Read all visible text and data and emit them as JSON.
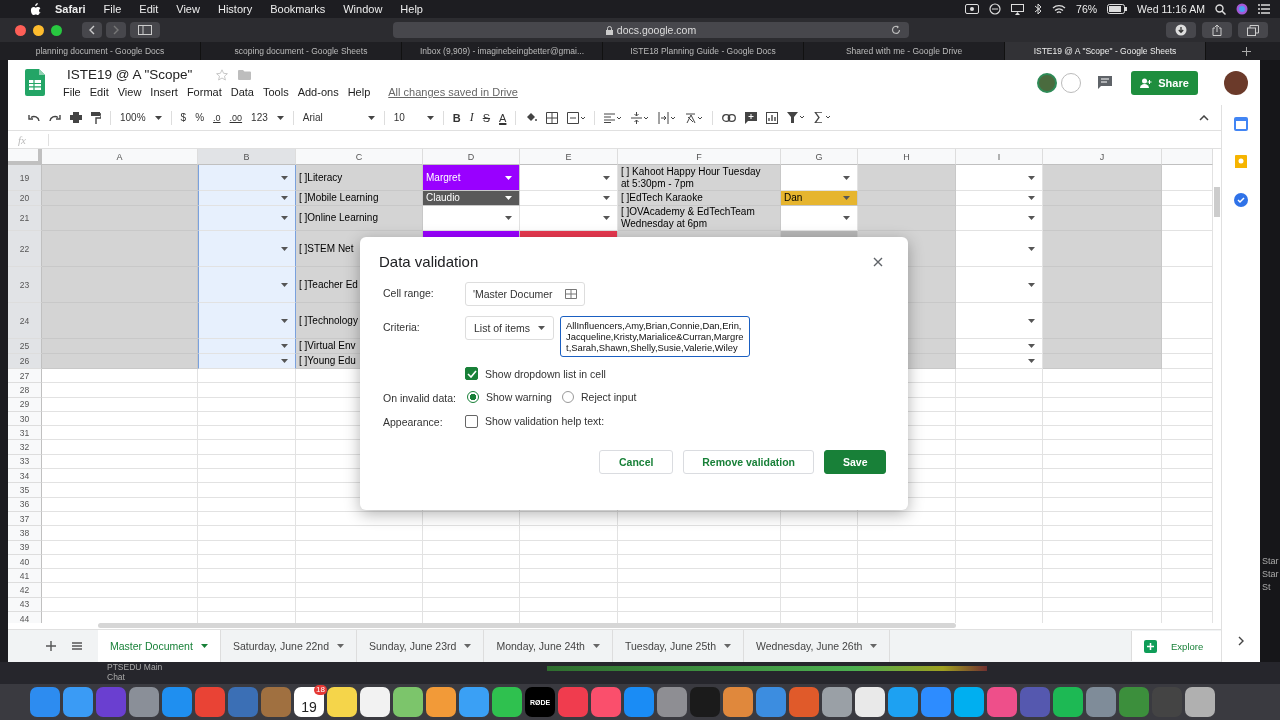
{
  "menubar": {
    "app": "Safari",
    "items": [
      "File",
      "Edit",
      "View",
      "History",
      "Bookmarks",
      "Window",
      "Help"
    ],
    "battery": "76%",
    "clock": "Wed 11:16 AM"
  },
  "browser": {
    "address": "docs.google.com",
    "tabs": [
      {
        "label": "planning document - Google Docs",
        "selected": false
      },
      {
        "label": "scoping document - Google Sheets",
        "selected": false
      },
      {
        "label": "Inbox (9,909) - imaginebeingbetter@gmai...",
        "selected": false
      },
      {
        "label": "ISTE18 Planning Guide - Google Docs",
        "selected": false
      },
      {
        "label": "Shared with me - Google Drive",
        "selected": false
      },
      {
        "label": "ISTE19 @ A \"Scope\" - Google Sheets",
        "selected": true
      }
    ]
  },
  "document": {
    "title": "ISTE19 @ A \"Scope\"",
    "menu": [
      "File",
      "Edit",
      "View",
      "Insert",
      "Format",
      "Data",
      "Tools",
      "Add-ons",
      "Help"
    ],
    "save_status": "All changes saved in Drive",
    "share": "Share"
  },
  "toolbar": {
    "zoom": "100%",
    "currency": "$",
    "percent": "%",
    "decrease_decimals": ".0",
    "increase_decimals": ".00",
    "number_format": "123",
    "font": "Arial",
    "font_size": "10",
    "bold": "B",
    "italic": "I",
    "strikethrough": "S",
    "text_color": "A"
  },
  "formula_bar": {
    "label": "fx"
  },
  "grid": {
    "columns": [
      {
        "label": "A",
        "selected": false
      },
      {
        "label": "B",
        "selected": true
      },
      {
        "label": "C",
        "selected": false
      },
      {
        "label": "D",
        "selected": false
      },
      {
        "label": "E",
        "selected": false
      },
      {
        "label": "F",
        "selected": false
      },
      {
        "label": "G",
        "selected": false
      },
      {
        "label": "H",
        "selected": false
      },
      {
        "label": "I",
        "selected": false
      },
      {
        "label": "J",
        "selected": false
      }
    ],
    "rows": [
      {
        "number": "19",
        "selected": true,
        "cells": [
          {
            "color": "#d4d4d4"
          },
          {
            "dropdown": true
          },
          {
            "text": "[ ]Literacy",
            "color": "#d4d4d4"
          },
          {
            "text": "Margret",
            "color": "#9900ff",
            "dropdown": true
          },
          {
            "dropdown": true
          },
          {
            "text": "[ ] Kahoot Happy Hour Tuesday at 5:30pm - 7pm",
            "color": "#d4d4d4"
          },
          {
            "dropdown": true
          },
          {
            "color": "#d4d4d4"
          },
          {
            "dropdown": true
          },
          {
            "color": "#d4d4d4"
          }
        ]
      },
      {
        "number": "20",
        "selected": true,
        "cells": [
          {
            "color": "#d4d4d4"
          },
          {
            "dropdown": true
          },
          {
            "text": "[ ]Mobile Learning",
            "color": "#d4d4d4"
          },
          {
            "text": "Claudio",
            "color": "#595959",
            "dropdown": true
          },
          {
            "dropdown": true
          },
          {
            "text": "[ ]EdTech Karaoke",
            "color": "#d4d4d4"
          },
          {
            "text": "Dan",
            "color": "#e6b52f",
            "dropdown": true
          },
          {
            "color": "#d4d4d4"
          },
          {
            "dropdown": true
          },
          {
            "color": "#d4d4d4"
          }
        ]
      },
      {
        "number": "21",
        "selected": true,
        "cells": [
          {
            "color": "#d4d4d4"
          },
          {
            "dropdown": true
          },
          {
            "text": "[ ]Online Learning",
            "color": "#d4d4d4"
          },
          {
            "dropdown": true
          },
          {
            "dropdown": true
          },
          {
            "text": "[ ]OVAcademy & EdTechTeam Wednesday at 6pm",
            "color": "#d4d4d4"
          },
          {
            "dropdown": true
          },
          {
            "color": "#d4d4d4"
          },
          {
            "dropdown": true
          },
          {
            "color": "#d4d4d4"
          }
        ]
      },
      {
        "number": "22",
        "selected": true,
        "cells": [
          {
            "color": "#d4d4d4"
          },
          {
            "dropdown": true
          },
          {
            "text": "[ ]STEM Net",
            "color": "#d4d4d4"
          },
          {
            "color": "#9900ff"
          },
          {
            "color": "#e8384f"
          },
          {
            "color": "#d4d4d4"
          },
          {
            "color": "#b7b7b7"
          },
          {
            "color": "#d4d4d4"
          },
          {
            "dropdown": true
          },
          {
            "color": "#d4d4d4"
          }
        ]
      },
      {
        "number": "23",
        "selected": true,
        "cells": [
          {
            "color": "#d4d4d4"
          },
          {
            "dropdown": true
          },
          {
            "text": "[ ]Teacher Ed",
            "color": "#d4d4d4"
          },
          {},
          {},
          {},
          {},
          {
            "color": "#d4d4d4"
          },
          {
            "dropdown": true
          },
          {
            "color": "#d4d4d4"
          }
        ]
      },
      {
        "number": "24",
        "selected": true,
        "cells": [
          {
            "color": "#d4d4d4"
          },
          {
            "dropdown": true
          },
          {
            "text": "[ ]Technology",
            "color": "#d4d4d4"
          },
          {},
          {},
          {},
          {},
          {
            "color": "#d4d4d4"
          },
          {
            "dropdown": true
          },
          {
            "color": "#d4d4d4"
          }
        ]
      },
      {
        "number": "25",
        "selected": true,
        "cells": [
          {
            "color": "#d4d4d4"
          },
          {
            "dropdown": true
          },
          {
            "text": "[ ]Virtual Env",
            "color": "#d4d4d4"
          },
          {},
          {},
          {},
          {},
          {
            "color": "#d4d4d4"
          },
          {
            "dropdown": true
          },
          {
            "color": "#d4d4d4"
          }
        ]
      },
      {
        "number": "26",
        "selected": true,
        "cells": [
          {
            "color": "#d4d4d4"
          },
          {
            "dropdown": true
          },
          {
            "text": "[ ]Young Edu",
            "color": "#d4d4d4"
          },
          {},
          {},
          {},
          {},
          {
            "color": "#d4d4d4"
          },
          {
            "dropdown": true
          },
          {
            "color": "#d4d4d4"
          }
        ]
      },
      {
        "number": "27",
        "selected": false
      },
      {
        "number": "28",
        "selected": false
      },
      {
        "number": "29",
        "selected": false
      },
      {
        "number": "30",
        "selected": false
      },
      {
        "number": "31",
        "selected": false
      },
      {
        "number": "32",
        "selected": false
      },
      {
        "number": "33",
        "selected": false
      },
      {
        "number": "34",
        "selected": false
      },
      {
        "number": "35",
        "selected": false
      },
      {
        "number": "36",
        "selected": false
      },
      {
        "number": "37",
        "selected": false
      },
      {
        "number": "38",
        "selected": false
      },
      {
        "number": "39",
        "selected": false
      },
      {
        "number": "40",
        "selected": false
      },
      {
        "number": "41",
        "selected": false
      },
      {
        "number": "42",
        "selected": false
      },
      {
        "number": "43",
        "selected": false
      },
      {
        "number": "44",
        "selected": false
      }
    ]
  },
  "sheet_tabs": [
    {
      "label": "Master Document",
      "selected": true
    },
    {
      "label": "Saturday, June 22nd",
      "selected": false
    },
    {
      "label": "Sunday, June 23rd",
      "selected": false
    },
    {
      "label": "Monday, June 24th",
      "selected": false
    },
    {
      "label": "Tuesday, June 25th",
      "selected": false
    },
    {
      "label": "Wednesday, June 26th",
      "selected": false
    }
  ],
  "explore": "Explore",
  "dialog": {
    "title": "Data validation",
    "cell_range_label": "Cell range:",
    "cell_range": "'Master Documer",
    "criteria_label": "Criteria:",
    "criteria_type": "List of items",
    "criteria_value": "AllInfluencers,Amy,Brian,Connie,Dan,Erin,Jacqueline,Kristy,Marialice&Curran,Margret,Sarah,Shawn,Shelly,Susie,Valerie,Wiley",
    "show_dropdown": {
      "label": "Show dropdown list in cell",
      "checked": true
    },
    "invalid_label": "On invalid data:",
    "invalid_options": [
      {
        "label": "Show warning",
        "selected": true
      },
      {
        "label": "Reject input",
        "selected": false
      }
    ],
    "appearance_label": "Appearance:",
    "help_text": {
      "label": "Show validation help text:",
      "checked": false
    },
    "buttons": [
      {
        "label": "Cancel",
        "kind": "secondary"
      },
      {
        "label": "Remove validation",
        "kind": "secondary"
      },
      {
        "label": "Save",
        "kind": "primary"
      }
    ]
  },
  "background_window": {
    "lines": [
      "PTSEDU Main",
      "Chat"
    ],
    "side_labels": [
      "Star",
      "Star",
      "St"
    ]
  },
  "dock": [
    {
      "kind": "app",
      "color": "#2d8cf0"
    },
    {
      "kind": "app",
      "color": "#3a9bf5"
    },
    {
      "kind": "app",
      "color": "#6a3fd0"
    },
    {
      "kind": "app",
      "color": "#8a8f98"
    },
    {
      "kind": "app",
      "color": "#1f8ff0"
    },
    {
      "kind": "app",
      "color": "#e94335"
    },
    {
      "kind": "app",
      "color": "#3b6fb5"
    },
    {
      "kind": "app",
      "color": "#a07040"
    },
    {
      "kind": "calendar",
      "color": "#ffffff",
      "day": "19",
      "badge": "18"
    },
    {
      "kind": "app",
      "color": "#f5d54a"
    },
    {
      "kind": "app",
      "color": "#f2f2f2"
    },
    {
      "kind": "app",
      "color": "#7cc56b"
    },
    {
      "kind": "app",
      "color": "#f29a38"
    },
    {
      "kind": "app",
      "color": "#3aa0f5"
    },
    {
      "kind": "app",
      "color": "#2fc14f"
    },
    {
      "kind": "label",
      "color": "#000000",
      "label": "RØDE"
    },
    {
      "kind": "app",
      "color": "#f03c4e"
    },
    {
      "kind": "app",
      "color": "#fa4f6c"
    },
    {
      "kind": "app",
      "color": "#1a8cf5"
    },
    {
      "kind": "app",
      "color": "#8e8e93"
    },
    {
      "kind": "app",
      "color": "#1b1b1b"
    },
    {
      "kind": "app",
      "color": "#e0883c"
    },
    {
      "kind": "app",
      "color": "#3c8de0"
    },
    {
      "kind": "app",
      "color": "#e05a2a"
    },
    {
      "kind": "app",
      "color": "#9aa0a6"
    },
    {
      "kind": "app",
      "color": "#e9e9e9"
    },
    {
      "kind": "app",
      "color": "#1da1f2"
    },
    {
      "kind": "app",
      "color": "#2d8cff"
    },
    {
      "kind": "app",
      "color": "#00aff0"
    },
    {
      "kind": "app",
      "color": "#ee4f8a"
    },
    {
      "kind": "app",
      "color": "#5558af"
    },
    {
      "kind": "app",
      "color": "#1db954"
    },
    {
      "kind": "app",
      "color": "#7f8c99"
    },
    {
      "kind": "app",
      "color": "#3c8f3c"
    },
    {
      "kind": "app",
      "color": "#444444"
    },
    {
      "kind": "app",
      "color": "#b0b0b0"
    }
  ]
}
